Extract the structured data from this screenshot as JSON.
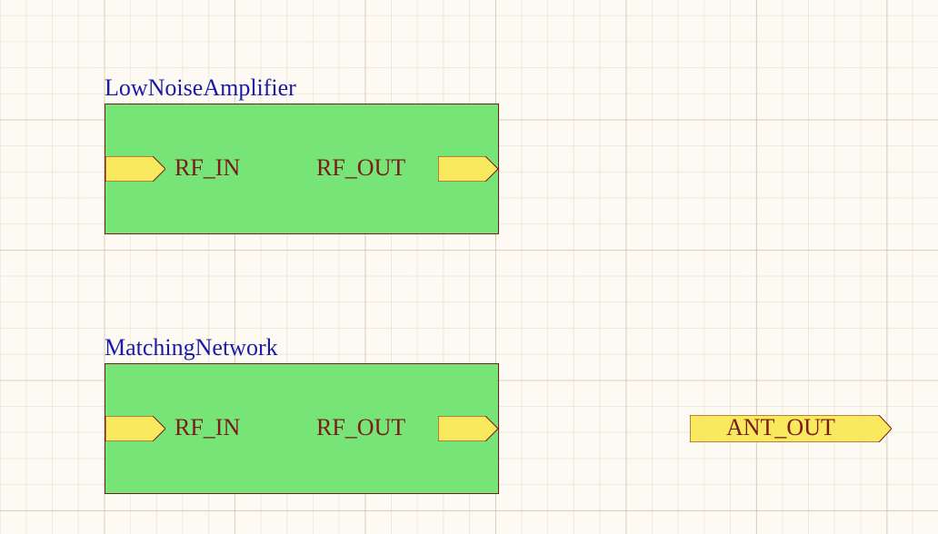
{
  "blocks": [
    {
      "title": "LowNoiseAmplifier",
      "in_label": "RF_IN",
      "out_label": "RF_OUT"
    },
    {
      "title": "MatchingNetwork",
      "in_label": "RF_IN",
      "out_label": "RF_OUT"
    }
  ],
  "standalone_port": {
    "label": "ANT_OUT"
  },
  "colors": {
    "block_fill": "#77e477",
    "block_stroke": "#7a1a1a",
    "port_fill": "#f8e95f",
    "port_stroke": "#7a1a1a",
    "title": "#1a1aa8",
    "label": "#7a1a1a"
  }
}
